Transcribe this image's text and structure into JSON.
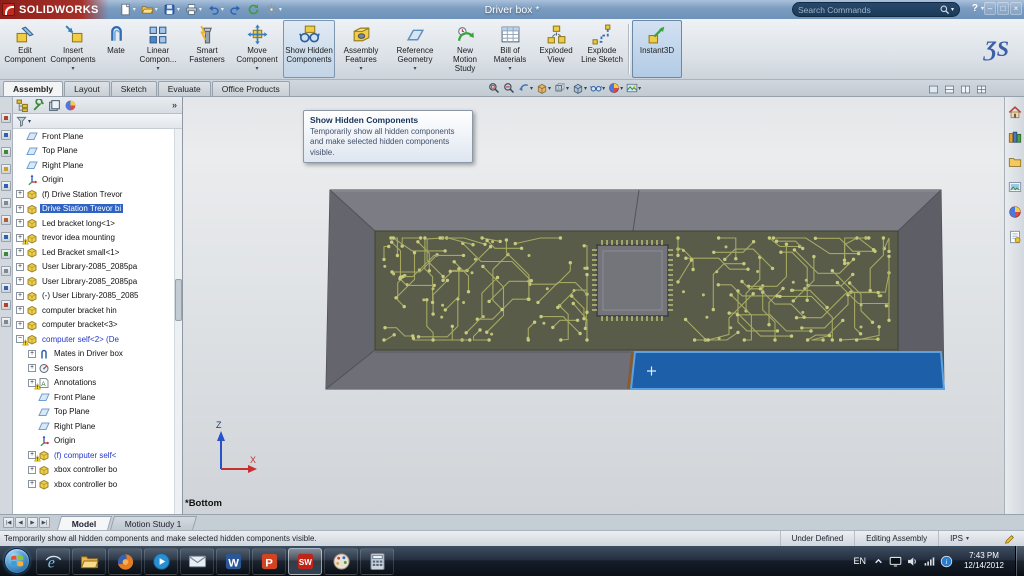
{
  "titlebar": {
    "logo_text": "SOLIDWORKS",
    "document_title": "Driver box *",
    "search_placeholder": "Search Commands",
    "help_label": "?",
    "window_buttons": [
      "–",
      "□",
      "×"
    ],
    "tools": [
      {
        "name": "new-document",
        "icon": "new",
        "dropdown": true
      },
      {
        "name": "open",
        "icon": "open",
        "dropdown": true
      },
      {
        "name": "save",
        "icon": "save",
        "dropdown": true
      },
      {
        "name": "print",
        "icon": "print",
        "dropdown": true
      },
      {
        "name": "undo",
        "icon": "undo",
        "dropdown": true
      },
      {
        "name": "redo",
        "icon": "redo",
        "dropdown": false
      },
      {
        "name": "rebuild",
        "icon": "rebuild",
        "dropdown": false
      },
      {
        "name": "options",
        "icon": "options",
        "dropdown": true
      }
    ]
  },
  "ribbon": {
    "ds_logo": "ƷS",
    "buttons": [
      {
        "label": "Edit Component",
        "icon": "edit-component",
        "dropdown": false,
        "state": "normal"
      },
      {
        "label": "Insert Components",
        "icon": "insert-components",
        "dropdown": true,
        "state": "normal"
      },
      {
        "label": "Mate",
        "icon": "mate",
        "dropdown": false,
        "state": "normal"
      },
      {
        "label": "Linear Compon...",
        "icon": "linear-pattern",
        "dropdown": true,
        "state": "normal"
      },
      {
        "label": "Smart Fasteners",
        "icon": "smart-fasteners",
        "dropdown": false,
        "state": "normal"
      },
      {
        "label": "Move Component",
        "icon": "move-component",
        "dropdown": true,
        "state": "normal"
      },
      {
        "label": "Show Hidden Components",
        "icon": "show-hidden",
        "dropdown": false,
        "state": "hover"
      },
      {
        "label": "Assembly Features",
        "icon": "assembly-features",
        "dropdown": true,
        "state": "normal"
      },
      {
        "label": "Reference Geometry",
        "icon": "reference-geometry",
        "dropdown": true,
        "state": "normal"
      },
      {
        "label": "New Motion Study",
        "icon": "motion-study",
        "dropdown": false,
        "state": "normal"
      },
      {
        "label": "Bill of Materials",
        "icon": "bom",
        "dropdown": true,
        "state": "normal"
      },
      {
        "label": "Exploded View",
        "icon": "exploded-view",
        "dropdown": false,
        "state": "normal"
      },
      {
        "label": "Explode Line Sketch",
        "icon": "explode-line",
        "dropdown": false,
        "state": "normal"
      },
      {
        "label": "Instant3D",
        "icon": "instant3d",
        "dropdown": false,
        "state": "active"
      }
    ]
  },
  "command_tabs": {
    "items": [
      {
        "label": "Assembly",
        "active": true
      },
      {
        "label": "Layout",
        "active": false
      },
      {
        "label": "Sketch",
        "active": false
      },
      {
        "label": "Evaluate",
        "active": false
      },
      {
        "label": "Office Products",
        "active": false
      }
    ]
  },
  "view_toolbar": [
    {
      "name": "zoom-fit",
      "icon": "zoom-fit",
      "dropdown": false
    },
    {
      "name": "zoom-area",
      "icon": "zoom-area",
      "dropdown": false
    },
    {
      "name": "previous-view",
      "icon": "previous-view",
      "dropdown": true
    },
    {
      "name": "section-view",
      "icon": "section-view",
      "dropdown": true
    },
    {
      "name": "view-orientation",
      "icon": "view-orientation",
      "dropdown": true
    },
    {
      "name": "display-style",
      "icon": "display-style",
      "dropdown": true
    },
    {
      "name": "hide-show-items",
      "icon": "glasses",
      "dropdown": true
    },
    {
      "name": "edit-appearance",
      "icon": "ball",
      "dropdown": true
    },
    {
      "name": "apply-scene",
      "icon": "scene",
      "dropdown": true
    }
  ],
  "window_tools": [
    {
      "name": "viewport-single",
      "icon": "full"
    },
    {
      "name": "viewport-split-horizontal",
      "icon": "splitv"
    },
    {
      "name": "viewport-split-vertical",
      "icon": "split"
    },
    {
      "name": "viewport-four-view",
      "icon": "grid"
    }
  ],
  "tooltip": {
    "title": "Show Hidden Components",
    "body": "Temporarily show all hidden components and make selected hidden components visible."
  },
  "left_toolbar": {
    "button_count": 13
  },
  "feature_tree": {
    "collapse_chevron": "»",
    "items": [
      {
        "label": "Front Plane",
        "icon": "plane",
        "indent": 0
      },
      {
        "label": "Top Plane",
        "icon": "plane",
        "indent": 0
      },
      {
        "label": "Right Plane",
        "icon": "plane",
        "indent": 0
      },
      {
        "label": "Origin",
        "icon": "origin",
        "indent": 0
      },
      {
        "label": "(f) Drive Station Trevor",
        "icon": "part",
        "indent": 0,
        "expand": "plus"
      },
      {
        "label": "Drive Station Trevor bi",
        "icon": "part",
        "indent": 0,
        "expand": "plus",
        "selected": true
      },
      {
        "label": "Led bracket long<1>",
        "icon": "part",
        "indent": 0,
        "expand": "plus"
      },
      {
        "label": "trevor idea mounting",
        "icon": "part",
        "indent": 0,
        "expand": "plus",
        "warn": true
      },
      {
        "label": "Led Bracket small<1>",
        "icon": "part",
        "indent": 0,
        "expand": "plus"
      },
      {
        "label": "User Library-2085_2085pa",
        "icon": "part",
        "indent": 0,
        "expand": "plus"
      },
      {
        "label": "User Library-2085_2085pa",
        "icon": "part",
        "indent": 0,
        "expand": "plus"
      },
      {
        "label": "(-) User Library-2085_2085",
        "icon": "part",
        "indent": 0,
        "expand": "plus"
      },
      {
        "label": "computer bracket hin",
        "icon": "part",
        "indent": 0,
        "expand": "plus"
      },
      {
        "label": "computer bracket<3>",
        "icon": "part",
        "indent": 0,
        "expand": "plus"
      },
      {
        "label": "computer self<2> (De",
        "icon": "part",
        "indent": 0,
        "expand": "minus",
        "blue": true,
        "warn": true
      },
      {
        "label": "Mates in Driver box",
        "icon": "mates",
        "indent": 1,
        "expand": "plus"
      },
      {
        "label": "Sensors",
        "icon": "sensors",
        "indent": 1,
        "expand": "plus"
      },
      {
        "label": "Annotations",
        "icon": "annotations",
        "indent": 1,
        "expand": "plus",
        "warn": true
      },
      {
        "label": "Front Plane",
        "icon": "plane",
        "indent": 1
      },
      {
        "label": "Top Plane",
        "icon": "plane",
        "indent": 1
      },
      {
        "label": "Right Plane",
        "icon": "plane",
        "indent": 1
      },
      {
        "label": "Origin",
        "icon": "origin",
        "indent": 1
      },
      {
        "label": "(f) computer self<",
        "icon": "part",
        "indent": 1,
        "expand": "plus",
        "blue": true,
        "warn": true
      },
      {
        "label": "xbox controller bo",
        "icon": "part",
        "indent": 1,
        "expand": "plus"
      },
      {
        "label": "xbox controller bo",
        "icon": "part",
        "indent": 1,
        "expand": "plus"
      }
    ]
  },
  "viewport": {
    "view_label": "*Bottom",
    "axis_labels": {
      "vertical": "Z",
      "horizontal": "X"
    }
  },
  "task_pane": [
    {
      "name": "solidworks-resources",
      "icon": "home"
    },
    {
      "name": "design-library",
      "icon": "library"
    },
    {
      "name": "file-explorer",
      "icon": "folder16"
    },
    {
      "name": "view-palette",
      "icon": "palette"
    },
    {
      "name": "appearances-scenes",
      "icon": "ball"
    },
    {
      "name": "custom-properties",
      "icon": "props"
    }
  ],
  "model_tabs": {
    "nav": [
      "|◀",
      "◀",
      "▶",
      "▶|"
    ],
    "items": [
      {
        "label": "Model",
        "active": true
      },
      {
        "label": "Motion Study 1",
        "active": false
      }
    ]
  },
  "statusbar": {
    "message": "Temporarily show all hidden components and make selected hidden components visible.",
    "items": [
      "Under Defined",
      "Editing Assembly"
    ],
    "units": "IPS"
  },
  "taskbar": {
    "apps": [
      {
        "name": "internet-explorer",
        "icon": "ie"
      },
      {
        "name": "windows-explorer",
        "icon": "explorer"
      },
      {
        "name": "firefox",
        "icon": "firefox"
      },
      {
        "name": "media-player",
        "icon": "media"
      },
      {
        "name": "mail",
        "icon": "mail"
      },
      {
        "name": "word",
        "icon": "word"
      },
      {
        "name": "powerpoint",
        "icon": "powerpoint"
      },
      {
        "name": "solidworks",
        "icon": "solidworks",
        "active": true
      },
      {
        "name": "paint",
        "icon": "paint"
      },
      {
        "name": "calculator",
        "icon": "calc"
      }
    ],
    "tray": {
      "language": "EN",
      "time": "7:43 PM",
      "date": "12/14/2012"
    }
  }
}
